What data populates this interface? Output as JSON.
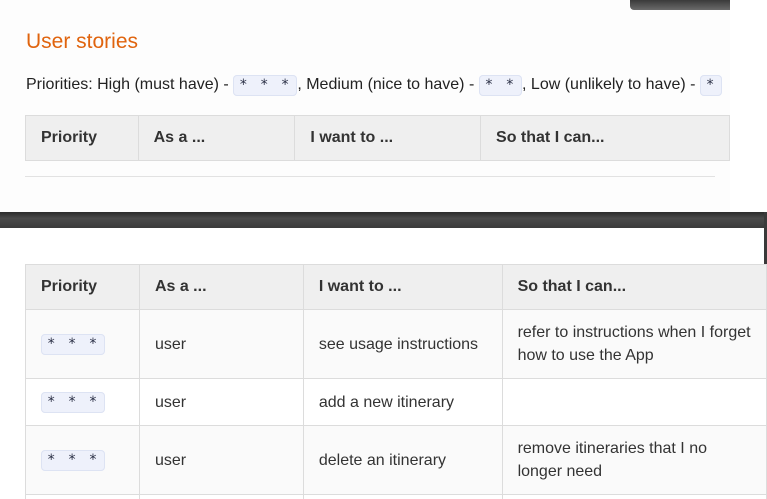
{
  "section": {
    "title": "User stories",
    "priorities_prefix": "Priorities: High (must have) - ",
    "high_code": "* * *",
    "medium_text": ", Medium (nice to have) - ",
    "medium_code": "* *",
    "low_text": ", Low (unlikely to have) - ",
    "low_code": "*"
  },
  "table": {
    "headers": [
      "Priority",
      "As a ...",
      "I want to ...",
      "So that I can..."
    ],
    "rows": [
      {
        "priority": "* * *",
        "as_a": "user",
        "want": "see usage instructions",
        "so_that": "refer to instructions when I forget how to use the App"
      },
      {
        "priority": "* * *",
        "as_a": "user",
        "want": "add a new itinerary",
        "so_that": ""
      },
      {
        "priority": "* * *",
        "as_a": "user",
        "want": "delete an itinerary",
        "so_that": "remove itineraries that I no longer need"
      }
    ]
  },
  "colors": {
    "title": "#e0640e",
    "code_bg": "#eef1fb",
    "header_bg": "#efefef"
  }
}
